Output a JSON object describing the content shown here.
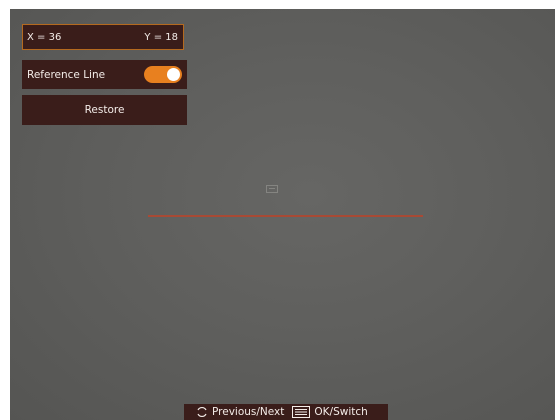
{
  "overlay": {
    "x_label": "X = 36",
    "y_label": "Y = 18",
    "reference_line_label": "Reference Line",
    "reference_line_enabled": true,
    "restore_label": "Restore"
  },
  "hints": {
    "prev_next": "Previous/Next",
    "ok_switch": "OK/Switch"
  },
  "colors": {
    "panel": "#3a1d1a",
    "accent": "#e8801f",
    "reference_line": "#a84a35"
  },
  "icons": {
    "rotate": "rotate-icon",
    "menu": "menu-icon",
    "center": "target-icon"
  }
}
